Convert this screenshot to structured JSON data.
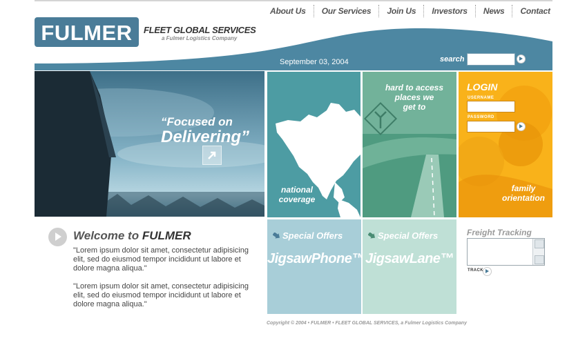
{
  "nav": [
    "About Us",
    "Our Services",
    "Join Us",
    "Investors",
    "News",
    "Contact"
  ],
  "logo": {
    "text": "FULMER"
  },
  "brand": {
    "title": "FLEET GLOBAL SERVICES",
    "subtitle": "a Fulmer Logistics Company"
  },
  "header": {
    "date": "September 03, 2004",
    "search_label": "search"
  },
  "hero": {
    "line1": "“Focused on",
    "line2": "Delivering”"
  },
  "panels": {
    "national": [
      "national",
      "coverage"
    ],
    "hard": [
      "hard to access",
      "places we",
      "get to"
    ],
    "family": [
      "family",
      "orientation"
    ]
  },
  "login": {
    "title": "LOGIN",
    "username_label": "USERNAME",
    "password_label": "PASSWORD"
  },
  "welcome": {
    "prefix": "Welcome to",
    "brand": "FULMER",
    "paragraphs": [
      "\"Lorem ipsum dolor sit amet, consectetur adipisicing elit, sed do eiusmod tempor incididunt ut labore et dolore magna aliqua.\"",
      "\"Lorem ipsum dolor sit amet, consectetur adipisicing elit, sed do eiusmod tempor incididunt ut labore et dolore magna aliqua.\""
    ]
  },
  "offers": [
    {
      "title": "Special Offers",
      "name": "JigsawPhone™",
      "color": "#a8ced8"
    },
    {
      "title": "Special Offers",
      "name": "JigsawLane™",
      "color": "#bfe0d6"
    }
  ],
  "freight": {
    "title": "Freight Tracking",
    "track_label": "TRACK"
  },
  "footer": {
    "copyright": "Copyright © 2004  •  FULMER  •  FLEET GLOBAL SERVICES, a Fulmer Logistics Company"
  },
  "colors": {
    "brand": "#4a7c98",
    "teal": "#4d9ca3",
    "green": "#72b29a",
    "orange": "#f9b21a"
  }
}
